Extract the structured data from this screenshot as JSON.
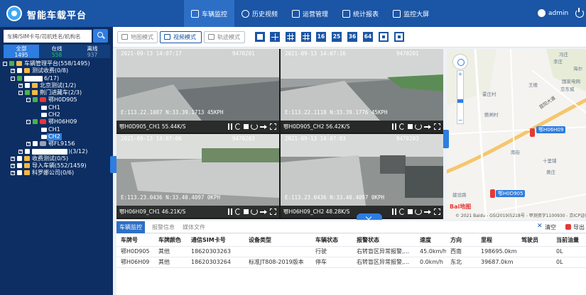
{
  "app": {
    "title": "智能车载平台"
  },
  "nav": [
    {
      "label": "车辆监控"
    },
    {
      "label": "历史视频"
    },
    {
      "label": "运营管理"
    },
    {
      "label": "统计报表"
    },
    {
      "label": "监控大屏"
    }
  ],
  "user": {
    "name": "admin"
  },
  "sidebar": {
    "search_placeholder": "车牌/SIM卡号/司机姓名/机构名",
    "filters": [
      {
        "label": "全部",
        "count": "1495"
      },
      {
        "label": "在线",
        "count": "558"
      },
      {
        "label": "离线",
        "count": "937"
      }
    ],
    "tree": [
      {
        "text": "车辆管理平台(558/1495)"
      },
      {
        "text": "测试收费(0/8)"
      },
      {
        "text": "6/17)"
      },
      {
        "text": "北京测试(1/2)"
      },
      {
        "text": "荆门进藏车(2/3)"
      },
      {
        "text": "鄂H0D905"
      },
      {
        "text": "CH1"
      },
      {
        "text": "CH2"
      },
      {
        "text": "鄂H06H09"
      },
      {
        "text": "CH1"
      },
      {
        "text": "CH2"
      },
      {
        "text": "鄂FL9156"
      },
      {
        "text": ")(3/12)"
      },
      {
        "text": "收费测试(0/5)"
      },
      {
        "text": "导入车辆(552/1459)"
      },
      {
        "text": "科罗娜公司(0/6)"
      }
    ]
  },
  "toolbar": {
    "map_mode": "地图模式",
    "video_mode": "视频模式",
    "track_mode": "轨迹模式",
    "layouts": [
      "",
      "",
      "",
      "",
      "16",
      "25",
      "36",
      "64",
      "",
      ""
    ]
  },
  "videos": [
    {
      "timestamp": "2021-09-13  14:07:17",
      "device": "9470201",
      "coords": "E:113.22.1087  N:33.39.1713  45KPH",
      "label": "鄂H0D905_CH1 55.44K/S"
    },
    {
      "timestamp": "2021-09-13  14:07:16",
      "device": "9470201",
      "coords": "E:113.22.1118  N:33.39.1776  45KPH",
      "label": "鄂H0D905_CH2 56.42K/S"
    },
    {
      "timestamp": "2021-09-13  14:07:06",
      "device": "9470203",
      "coords": "E:113.23.0436  N:33.40.4097  0KPH",
      "label": "鄂H06H09_CH1 46.21K/S"
    },
    {
      "timestamp": "2021-09-13  14:07:03",
      "device": "9470203",
      "coords": "E:113.23.0436  N:33.40.4097  0KPH",
      "label": "鄂H06H09_CH2 48.28K/S"
    }
  ],
  "map": {
    "labels": [
      "冯庄",
      "李庄",
      "海尔",
      "国家电网",
      "京东城",
      "王楼",
      "霍庄村",
      "鲍闸村",
      "十里铺",
      "黄庄",
      "南街",
      "建设路"
    ],
    "road_label": "昆阳大道",
    "markers": [
      "鄂H06H09",
      "鄂H0D905"
    ],
    "logo": "Bai地图",
    "copyright": "© 2021 Baidu - GS(2019)5218号 - 甲测资字1100930 - 京ICP证030173号"
  },
  "bottom": {
    "tabs": [
      "车辆监控",
      "报警信息",
      "媒体文件"
    ],
    "clear": "清空",
    "export": "导出"
  },
  "table": {
    "headers": [
      "车牌号",
      "车牌颜色",
      "通信SIM卡号",
      "设备类型",
      "车辆状态",
      "报警状态",
      "速度",
      "方向",
      "里程",
      "驾驶员",
      "当前油量"
    ],
    "rows": [
      [
        "鄂H0D905",
        "其他",
        "18620303263",
        "",
        "行驶",
        "右转盲区异常报警,...",
        "45.0km/h",
        "西南",
        "198695.0km",
        "",
        "0L"
      ],
      [
        "鄂H06H09",
        "其他",
        "18620303264",
        "标准JT808-2019版本",
        "停车",
        "右转盲区异常报警,...",
        "0.0km/h",
        "东北",
        "39687.0km",
        "",
        "0L"
      ]
    ]
  },
  "colors": {
    "primary": "#1b55a5",
    "sidebar": "#0c2e63",
    "accent": "#2e7de0",
    "online": "#22c55e",
    "alert": "#e53935"
  }
}
